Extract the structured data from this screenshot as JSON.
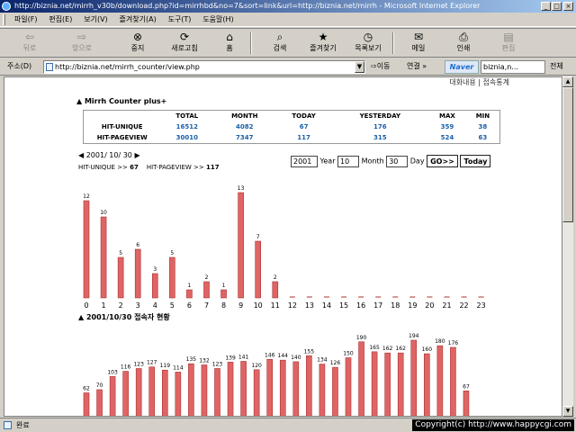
{
  "window": {
    "title": "http://biznia.net/mirrh_v30b/download.php?id=mirrhbd&no=7&sort=link&url=http://biznia.net/mirrh - Microsoft Internet Explorer"
  },
  "menu": [
    "파일(F)",
    "편집(E)",
    "보기(V)",
    "즐겨찾기(A)",
    "도구(T)",
    "도움말(H)"
  ],
  "toolbar": {
    "back": "뒤로",
    "forward": "앞으로",
    "stop": "중지",
    "refresh": "새로고침",
    "home": "홈",
    "search": "검색",
    "favorites": "즐겨찾기",
    "history": "목록보기",
    "mail": "메일",
    "print": "인쇄",
    "edit": "편집"
  },
  "address": {
    "label": "주소(D)",
    "url": "http://biznia.net/mirrh_counter/view.php",
    "go": "이동",
    "links": "연결 »",
    "naver_logo": "Naver",
    "naver_search": "biznia,n...",
    "all_search": "전체"
  },
  "page": {
    "top_links": "대화내용 | 접속통계",
    "counter_title": "▲ Mirrh Counter plus+",
    "table": {
      "headers": [
        "",
        "TOTAL",
        "MONTH",
        "TODAY",
        "YESTERDAY",
        "MAX",
        "MIN"
      ],
      "rows": [
        [
          "HIT-UNIQUE",
          "16512",
          "4082",
          "67",
          "176",
          "359",
          "38"
        ],
        [
          "HIT-PAGEVIEW",
          "30010",
          "7347",
          "117",
          "315",
          "524",
          "63"
        ]
      ]
    },
    "date_nav": {
      "prev": "◀",
      "date": "2001/ 10/ 30",
      "next": "▶"
    },
    "summary": {
      "unique_label": "HIT-UNIQUE >>",
      "unique_value": "67",
      "pageview_label": "HIT-PAGEVIEW >>",
      "pageview_value": "117"
    },
    "form": {
      "year_value": "2001",
      "year_label": "Year",
      "month_value": "10",
      "month_label": "Month",
      "day_value": "30",
      "day_label": "Day",
      "go_button": "GO>>",
      "today_button": "Today"
    },
    "daily_title": "▲ 2001/10/30 접속자 현황"
  },
  "chart_data": [
    {
      "type": "bar",
      "categories": [
        "0",
        "1",
        "2",
        "3",
        "4",
        "5",
        "6",
        "7",
        "8",
        "9",
        "10",
        "11",
        "12",
        "13",
        "14",
        "15",
        "16",
        "17",
        "18",
        "19",
        "20",
        "21",
        "22",
        "23"
      ],
      "values": [
        12,
        10,
        5,
        6,
        3,
        5,
        1,
        2,
        1,
        13,
        7,
        2,
        0,
        0,
        0,
        0,
        0,
        0,
        0,
        0,
        0,
        0,
        0,
        0
      ],
      "ylim": [
        0,
        13
      ],
      "bar_color": "#e06464",
      "bar_edge_color": "#a83232"
    },
    {
      "type": "bar",
      "title": "▲ 2001/10/30 접속자 현황",
      "values": [
        62,
        70,
        103,
        116,
        123,
        127,
        119,
        114,
        135,
        132,
        123,
        139,
        141,
        120,
        146,
        144,
        140,
        155,
        134,
        126,
        150,
        190,
        165,
        162,
        162,
        194,
        160,
        180,
        176,
        67
      ],
      "ylim": [
        0,
        194
      ],
      "bar_color": "#e06464",
      "bar_edge_color": "#a83232"
    }
  ],
  "status": {
    "text": "완료",
    "copyright": "Copyright(c) http://www.happycgi.com"
  }
}
